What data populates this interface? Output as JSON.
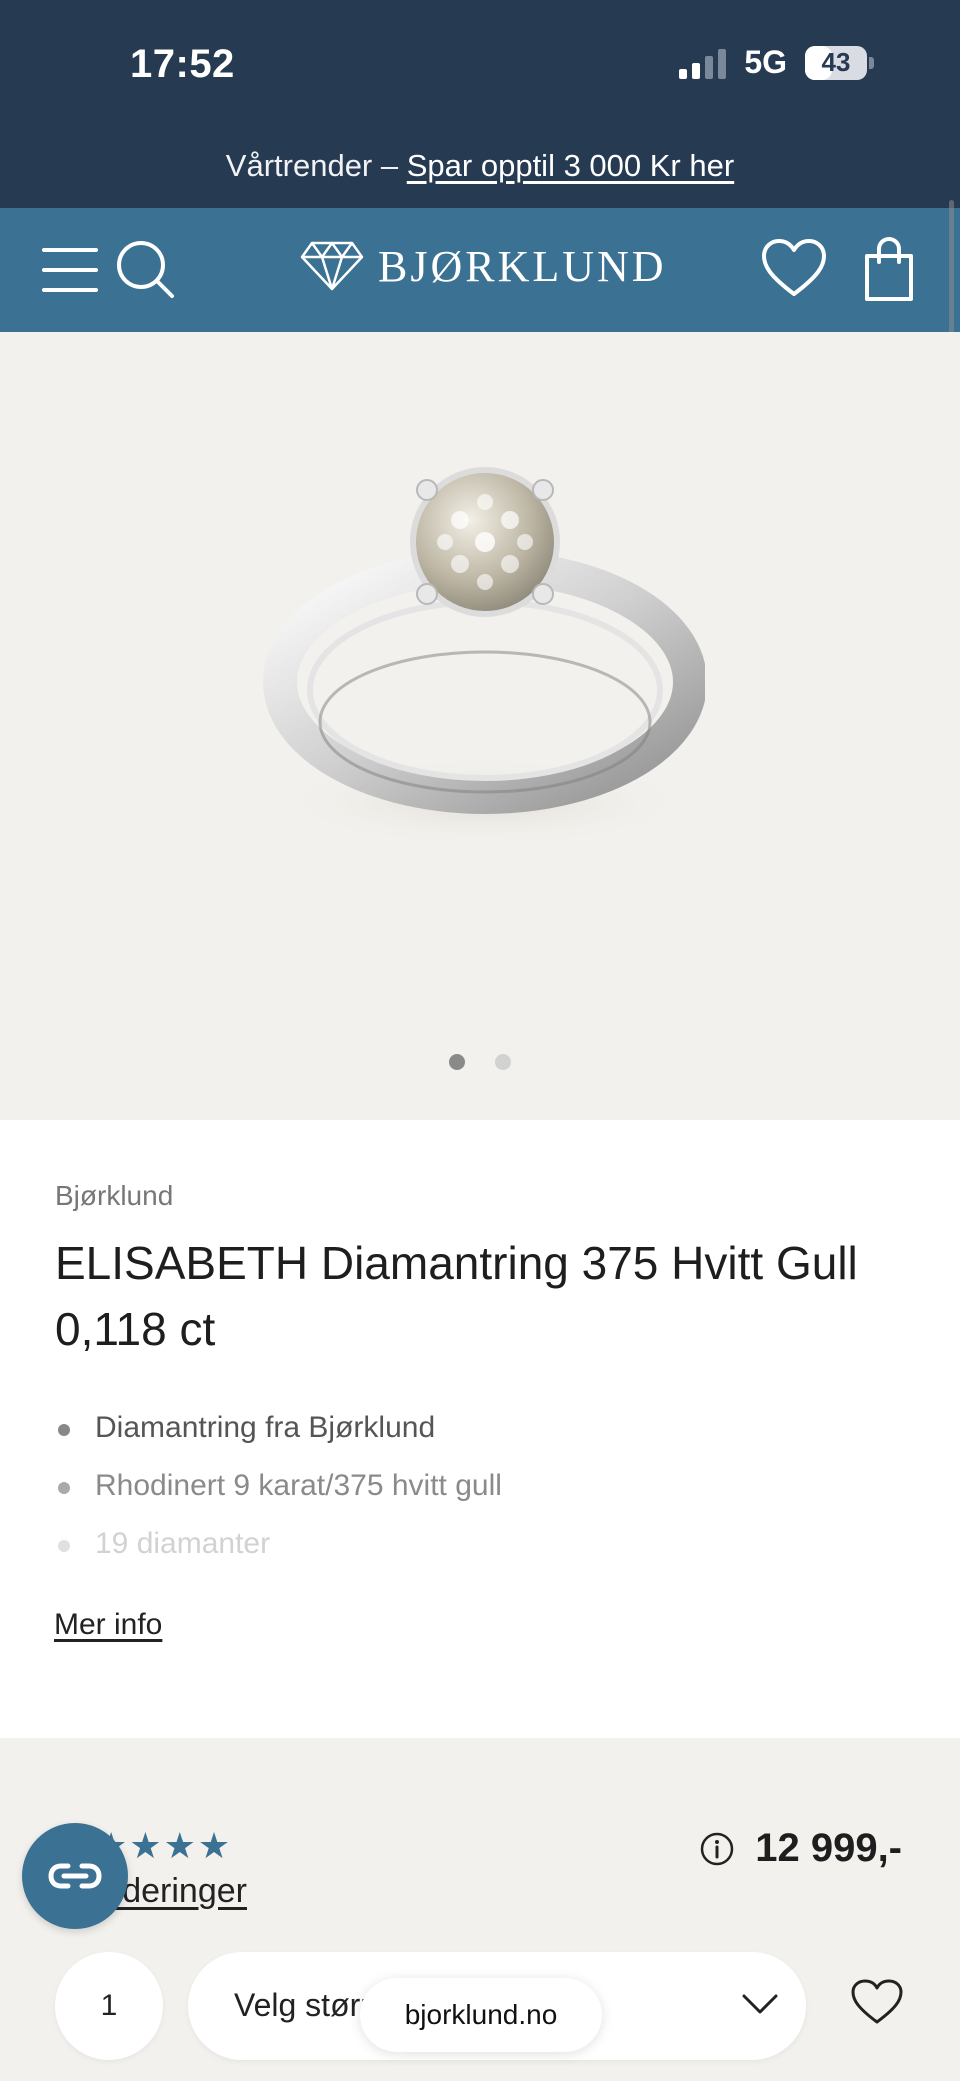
{
  "status_bar": {
    "time": "17:52",
    "network": "5G",
    "battery": "43",
    "battery_level": 0.43
  },
  "promo": {
    "prefix": "Vårtrender  –",
    "link": "Spar opptil 3 000 Kr her"
  },
  "header": {
    "logo": "BJØRKLUND"
  },
  "gallery": {
    "slides": 2,
    "active_slide": 1
  },
  "product": {
    "brand": "Bjørklund",
    "title": "ELISABETH Diamantring 375 Hvitt Gull 0,118 ct",
    "bullets": [
      "Diamantring fra Bjørklund",
      "Rhodinert 9 karat/375 hvitt gull",
      "19 diamanter"
    ],
    "more_info": "Mer info"
  },
  "purchase": {
    "rating_stars": 4,
    "reviews_link": "urderinger",
    "price": "12 999,-",
    "quantity": "1",
    "size_placeholder": "Velg størr",
    "url": "bjorklund.no"
  },
  "colors": {
    "navy": "#263a52",
    "header_blue": "#3b7192",
    "background": "#f3f1ed"
  }
}
